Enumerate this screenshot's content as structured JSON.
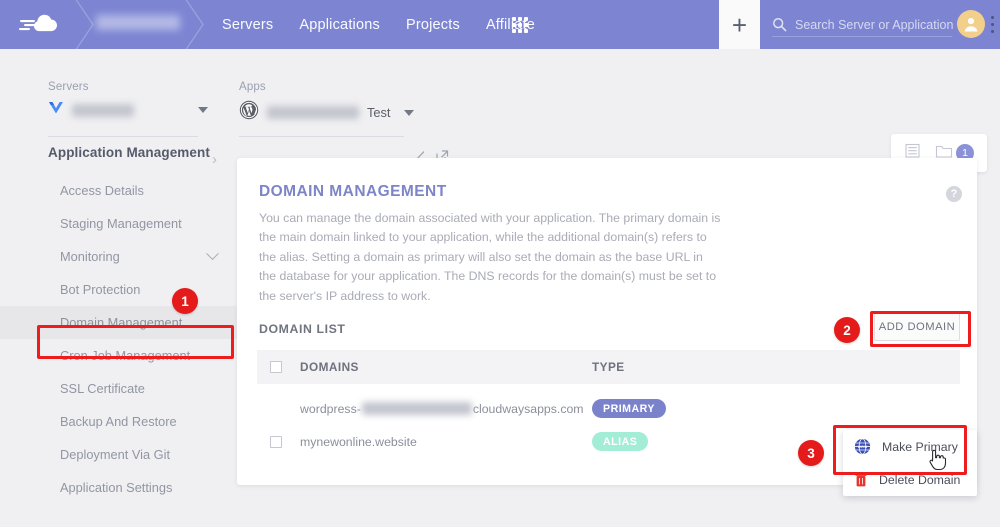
{
  "header": {
    "logo_icon": "cloudways-cloud-logo",
    "breadcrumb_blurred": "",
    "nav": [
      {
        "label": "Servers"
      },
      {
        "label": "Applications"
      },
      {
        "label": "Projects"
      },
      {
        "label": "Affiliate"
      }
    ],
    "apps_grid_icon": "grid-apps-icon",
    "add_button_label": "+",
    "search": {
      "icon": "search-icon",
      "placeholder": "Search Server or Application"
    },
    "avatar_icon": "user-avatar-icon",
    "overflow_icon": "vertical-dots-icon"
  },
  "breadcrumb": {
    "servers": {
      "label": "Servers",
      "icon": "vultr-server-icon",
      "name_blurred": "",
      "caret": "chevron-down-icon"
    },
    "separator": "›",
    "apps": {
      "label": "Apps",
      "icon": "wordpress-icon",
      "name_blurred": "",
      "suffix": "Test",
      "caret": "chevron-down-icon",
      "edit_icon": "pencil-edit-icon",
      "open_icon": "external-link-icon"
    },
    "topcard": {
      "list_icon": "list-view-icon",
      "folder_icon": "folder-icon",
      "badge_count": "1"
    }
  },
  "sidebar": {
    "title": "Application Management",
    "items": [
      {
        "label": "Access Details",
        "expandable": false
      },
      {
        "label": "Staging Management",
        "expandable": false
      },
      {
        "label": "Monitoring",
        "expandable": true
      },
      {
        "label": "Bot Protection",
        "expandable": false
      },
      {
        "label": "Domain Management",
        "expandable": false,
        "active": true
      },
      {
        "label": "Cron Job Management",
        "expandable": false
      },
      {
        "label": "SSL Certificate",
        "expandable": false
      },
      {
        "label": "Backup And Restore",
        "expandable": false
      },
      {
        "label": "Deployment Via Git",
        "expandable": false
      },
      {
        "label": "Application Settings",
        "expandable": false
      }
    ]
  },
  "main": {
    "title": "DOMAIN MANAGEMENT",
    "help_icon": "help-question-icon",
    "description": "You can manage the domain associated with your application. The primary domain is the main domain linked to your application, while the additional domain(s) refers to the alias. Setting a domain as primary will also set the domain as the base URL in the database for your application. The DNS records for the domain(s) must be set to the server's IP address to work.",
    "domain_list_label": "DOMAIN LIST",
    "add_domain_label": "ADD DOMAIN",
    "table": {
      "columns": [
        "DOMAINS",
        "TYPE"
      ],
      "rows": [
        {
          "domain_prefix": "wordpress-",
          "domain_blurred": true,
          "domain_suffix": "cloudwaysapps.com",
          "type": "PRIMARY",
          "has_checkbox": false
        },
        {
          "domain_prefix": "mynewonline.website",
          "domain_blurred": false,
          "domain_suffix": "",
          "type": "ALIAS",
          "has_checkbox": true
        }
      ]
    }
  },
  "context_menu": {
    "kebab_icon": "vertical-dots-icon",
    "items": [
      {
        "label": "Make Primary",
        "icon": "www-globe-icon"
      },
      {
        "label": "Delete Domain",
        "icon": "trash-icon"
      }
    ],
    "cursor": "pointer-hand-cursor"
  },
  "annotations": [
    {
      "number": "1",
      "target": "sidebar-item-domain-management"
    },
    {
      "number": "2",
      "target": "add-domain-button"
    },
    {
      "number": "3",
      "target": "make-primary-menu-item"
    }
  ],
  "colors": {
    "header_purple": "#7d85d3",
    "accent_purple": "#7a82cc",
    "alias_green": "#a3ecd6",
    "annotation_red": "#ee1c1c",
    "page_bg": "#f0f0f2"
  }
}
